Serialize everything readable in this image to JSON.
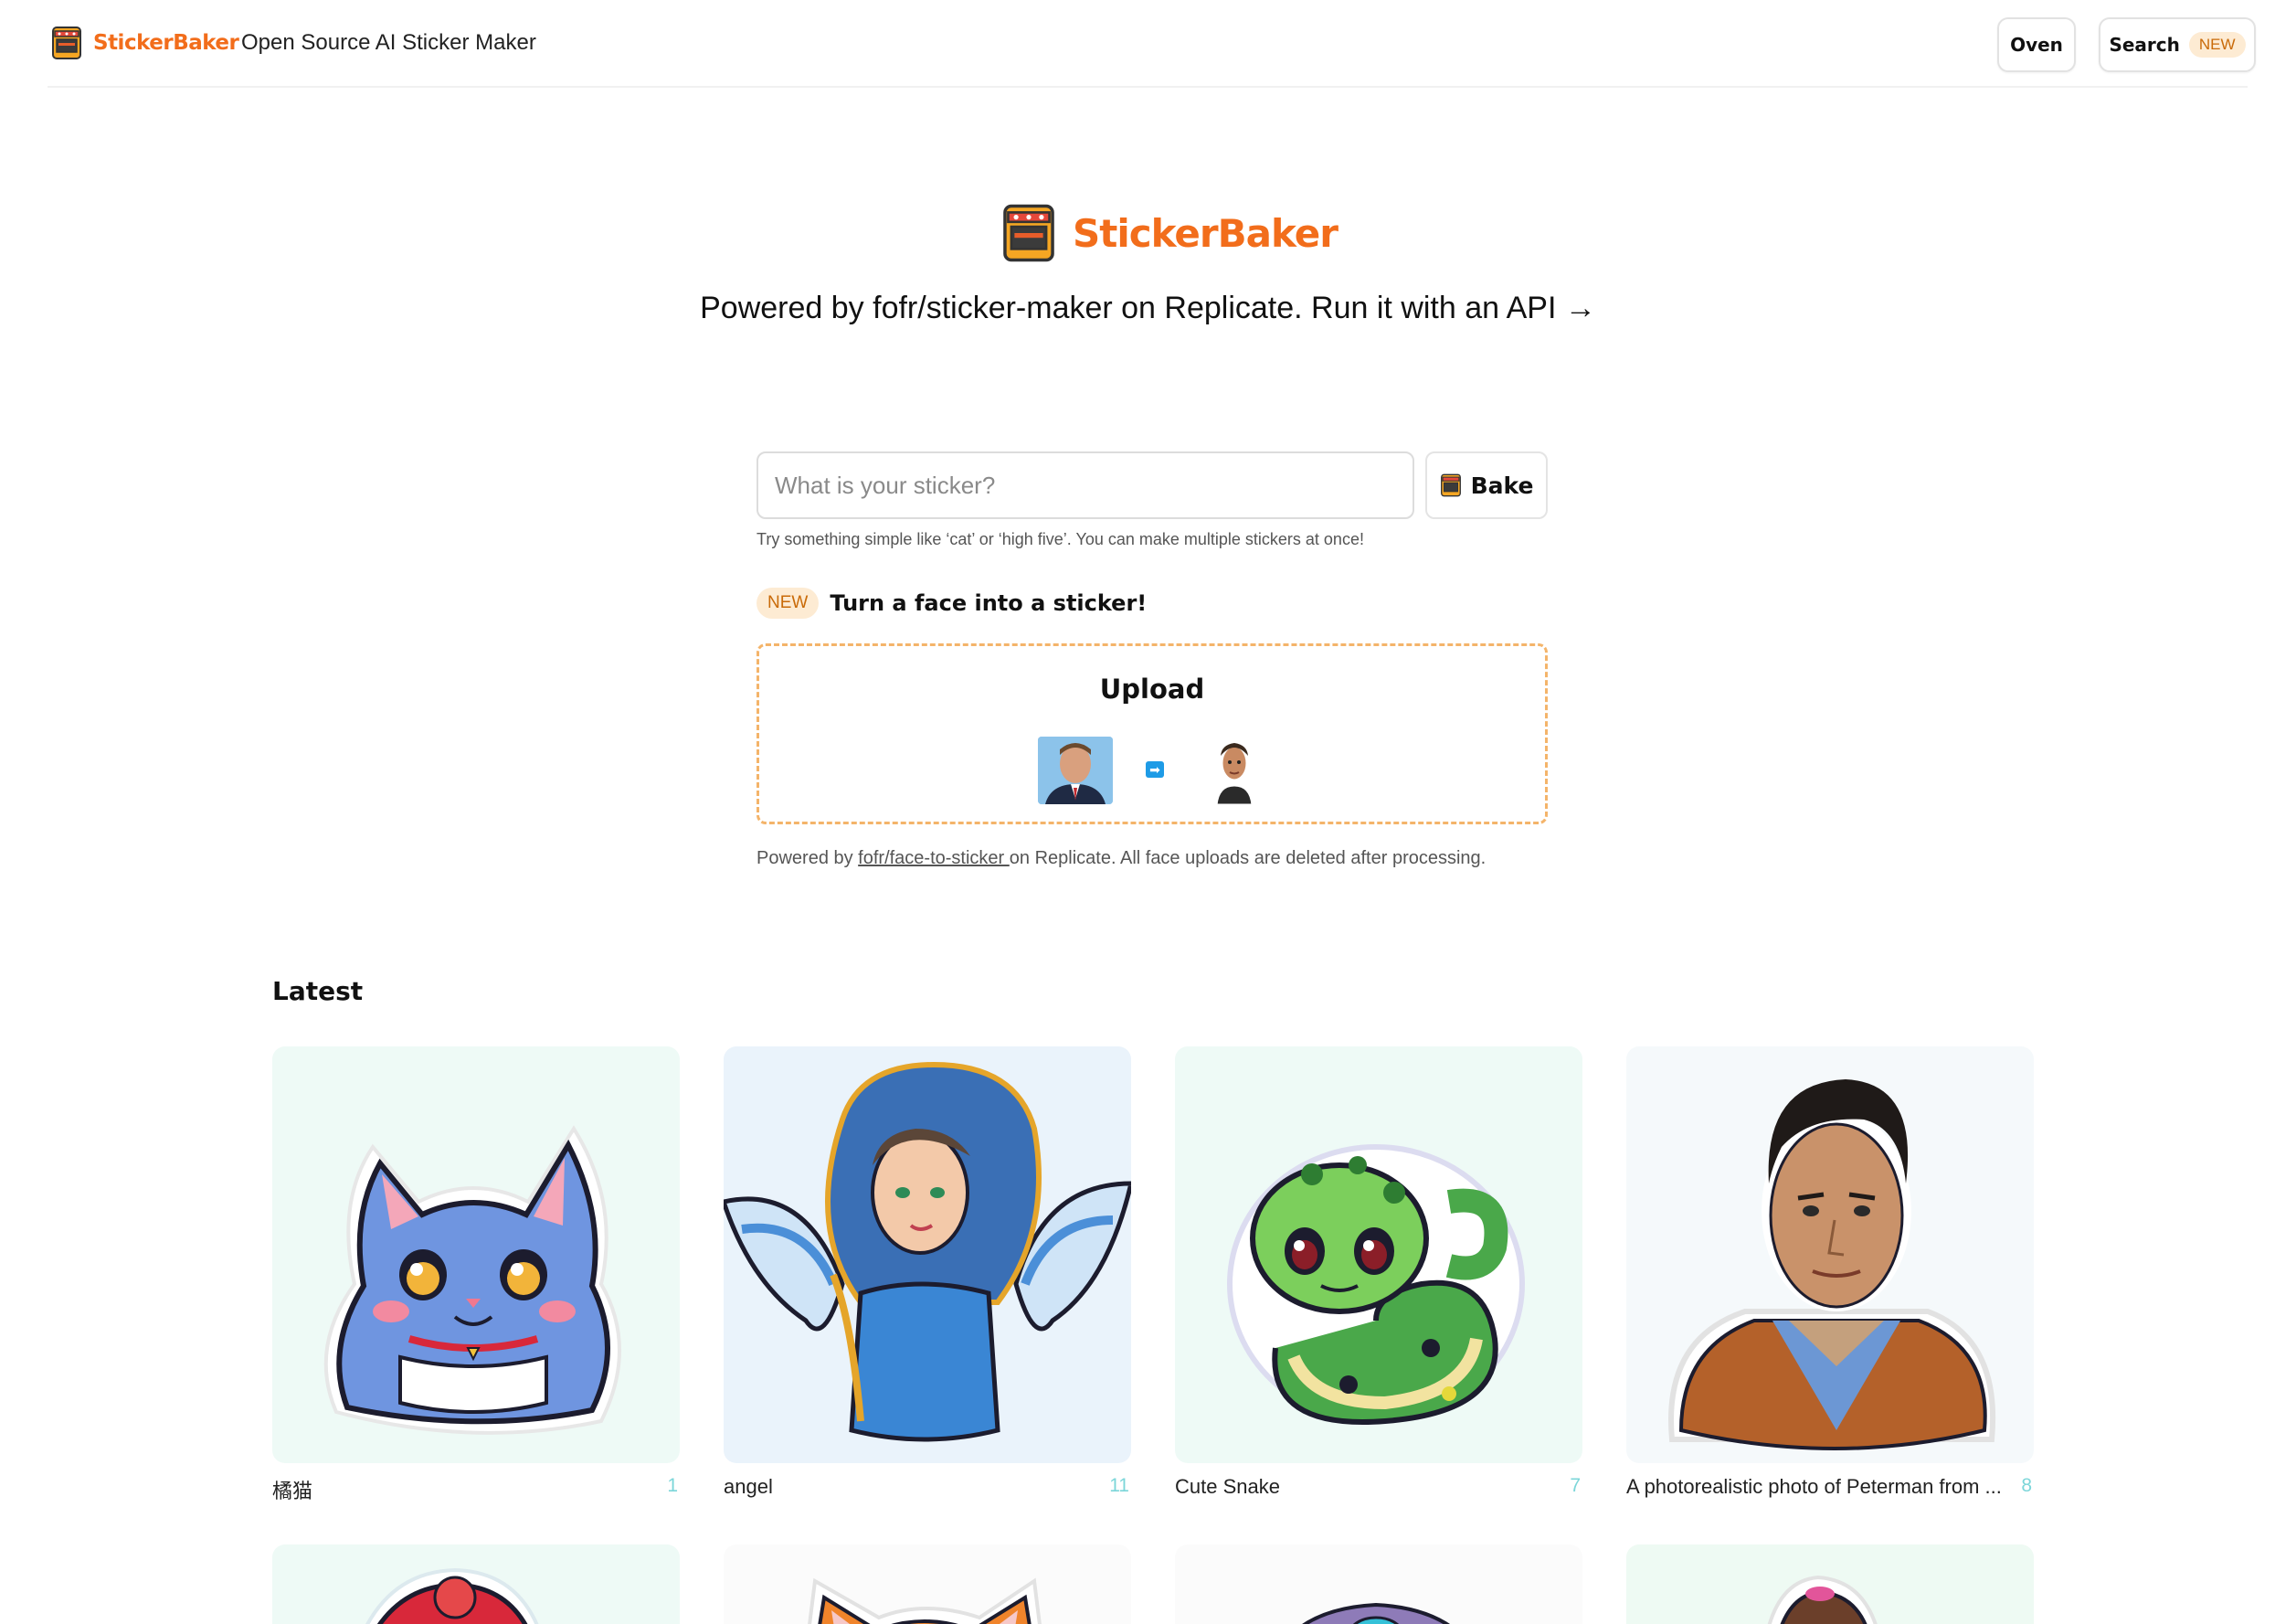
{
  "nav": {
    "brand": "StickerBaker",
    "tagline": "Open Source AI Sticker Maker",
    "oven_label": "Oven",
    "search_label": "Search",
    "search_badge": "NEW"
  },
  "hero": {
    "brand": "StickerBaker",
    "subtitle": "Powered by fofr/sticker-maker on Replicate. Run it with an API →"
  },
  "prompt": {
    "placeholder": "What is your sticker?",
    "bake_label": "Bake",
    "hint": "Try something simple like ‘cat’ or ‘high five’. You can make multiple stickers at once!"
  },
  "face": {
    "badge": "NEW",
    "title": "Turn a face into a sticker!",
    "upload_label": "Upload",
    "powered_prefix": "Powered by ",
    "powered_link": "fofr/face-to-sticker ",
    "powered_suffix": "on Replicate. All face uploads are deleted after processing."
  },
  "latest": {
    "title": "Latest",
    "items": [
      {
        "label": "橘猫",
        "count": "1",
        "icon": "blue-cat-sticker"
      },
      {
        "label": "angel",
        "count": "11",
        "icon": "angel-sticker"
      },
      {
        "label": "Cute Snake",
        "count": "7",
        "icon": "snake-sticker"
      },
      {
        "label": "A photorealistic photo of Peterman from ...",
        "count": "8",
        "icon": "man-portrait-sticker"
      }
    ]
  },
  "colors": {
    "brand_orange": "#f26d1b",
    "badge_bg": "#fdebd3",
    "dashed_border": "#f4b46a",
    "count_teal": "#7cd6d9"
  }
}
